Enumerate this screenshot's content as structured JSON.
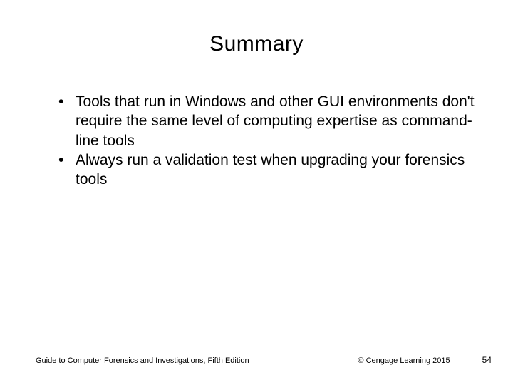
{
  "slide": {
    "title": "Summary",
    "bullets": [
      "Tools that run in Windows and other GUI environments don't require the same level of computing expertise as command-line tools",
      "Always run  a validation test when upgrading your forensics tools"
    ]
  },
  "footer": {
    "left": "Guide to Computer Forensics and Investigations, Fifth Edition",
    "center": "© Cengage Learning  2015",
    "page": "54"
  }
}
